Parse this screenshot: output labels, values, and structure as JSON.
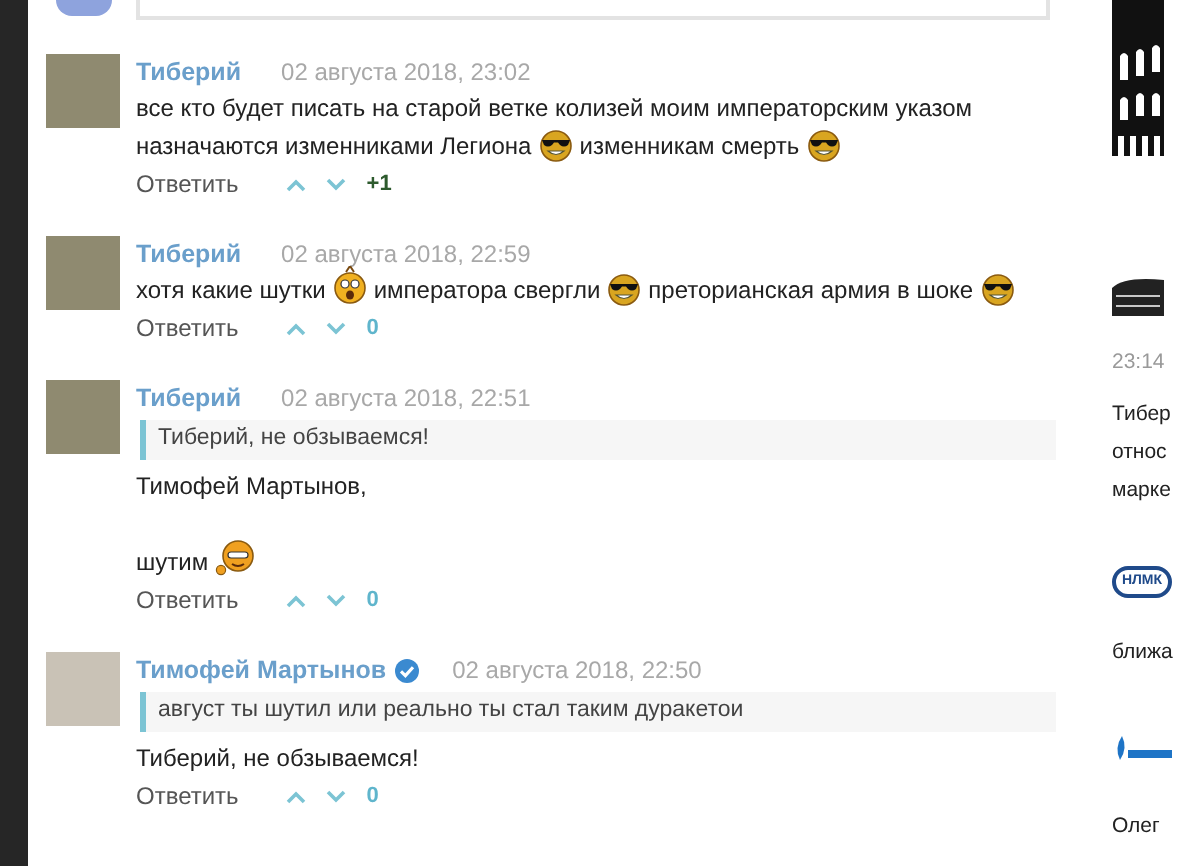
{
  "comments": [
    {
      "author": "Тиберий",
      "verified": false,
      "date": "02 августа 2018, 23:02",
      "paragraphs": [
        [
          [
            {
              "kind": "text",
              "text": "все кто будет писать на старой ветке колизей моим императорским указом"
            }
          ],
          [
            {
              "kind": "text",
              "text": "назначаются изменниками Легиона"
            },
            {
              "kind": "cool-emoji"
            },
            {
              "kind": "text",
              "text": "изменникам смерть"
            },
            {
              "kind": "cool-emoji"
            }
          ]
        ]
      ],
      "reply": "Ответить",
      "score": "+1",
      "positive": true
    },
    {
      "author": "Тиберий",
      "verified": false,
      "date": "02 августа 2018, 22:59",
      "paragraphs": [
        [
          [
            {
              "kind": "text",
              "text": "хотя какие шутки"
            },
            {
              "kind": "shock-emoji"
            },
            {
              "kind": "text",
              "text": "императора свергли"
            },
            {
              "kind": "cool-emoji"
            },
            {
              "kind": "text",
              "text": "преторианская армия в шоке"
            },
            {
              "kind": "cool-emoji"
            }
          ]
        ]
      ],
      "reply": "Ответить",
      "score": "0",
      "positive": false
    },
    {
      "author": "Тиберий",
      "verified": false,
      "date": "02 августа 2018, 22:51",
      "quote": "Тиберий, не обзываемся!",
      "paragraphs": [
        [
          [
            {
              "kind": "text",
              "text": "Тимофей Мартынов,"
            }
          ]
        ],
        [
          [
            {
              "kind": "text",
              "text": "шутим"
            },
            {
              "kind": "wink-emoji"
            }
          ]
        ]
      ],
      "reply": "Ответить",
      "score": "0",
      "positive": false
    },
    {
      "author": "Тимофей Мартынов",
      "verified": true,
      "date": "02 августа 2018, 22:50",
      "quote": "август ты шутил или реально ты стал таким дуракетои",
      "paragraphs": [
        [
          [
            {
              "kind": "text",
              "text": "Тиберий, не обзываемся!"
            }
          ]
        ]
      ],
      "reply": "Ответить",
      "score": "0",
      "positive": false
    }
  ],
  "sidebar": {
    "items": [
      {
        "kind": "colosseum-large"
      },
      {
        "kind": "colosseum-small"
      },
      {
        "kind": "time",
        "text": "23:14"
      },
      {
        "kind": "text",
        "lines": [
          "Тибер",
          "относ",
          "марке"
        ]
      },
      {
        "kind": "oval-logo",
        "text": "НЛМК"
      },
      {
        "kind": "text",
        "lines": [
          "ближа"
        ]
      },
      {
        "kind": "flame-logo"
      },
      {
        "kind": "text",
        "lines": [
          "Олег"
        ]
      }
    ]
  }
}
